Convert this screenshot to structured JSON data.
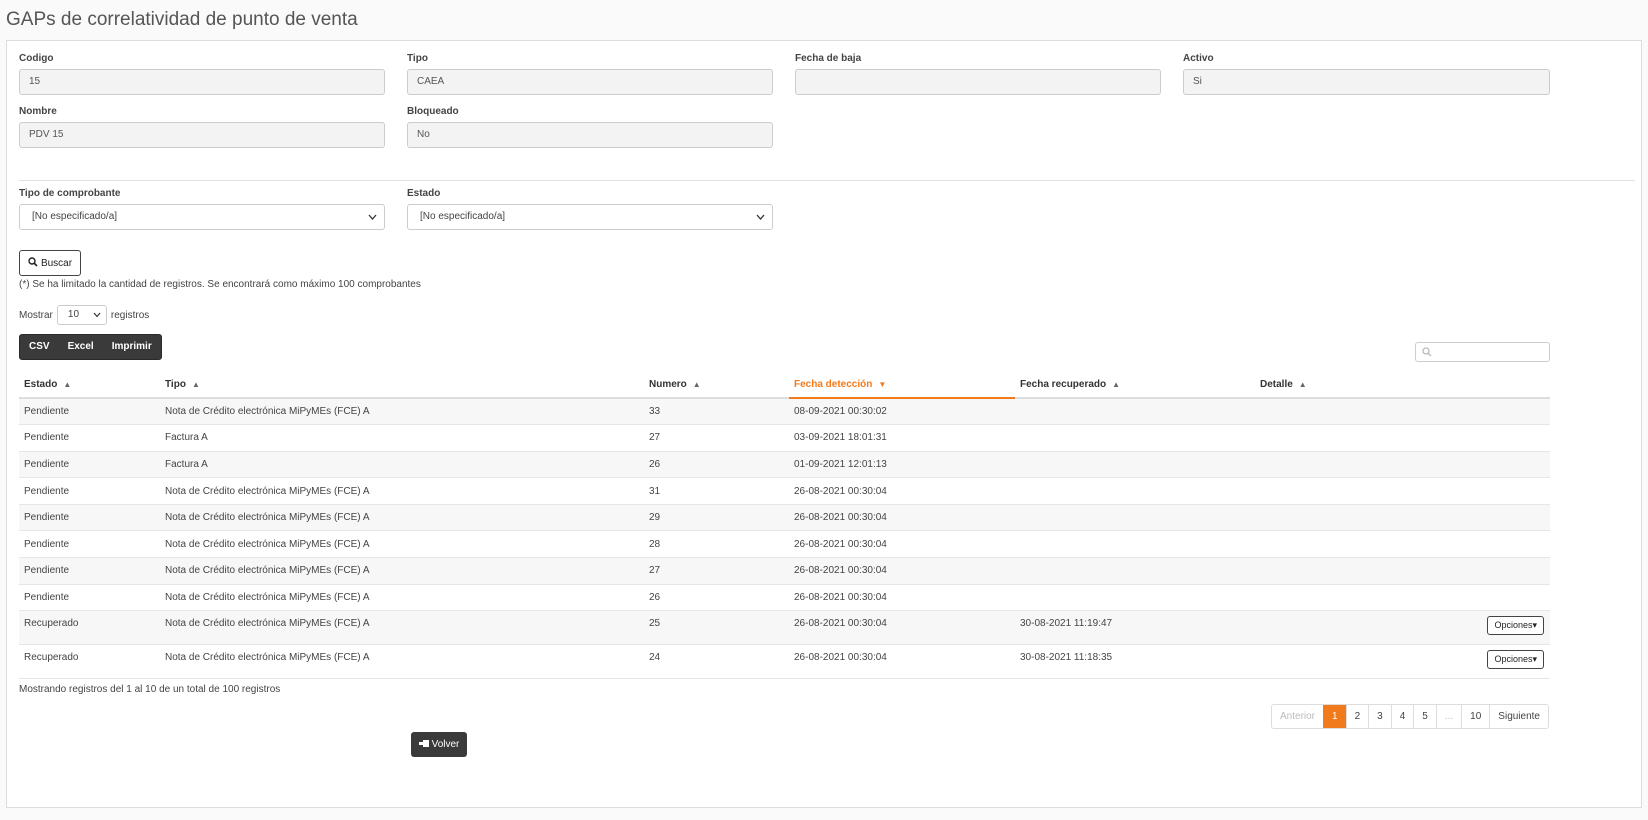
{
  "page_title": "GAPs de correlatividad de punto de venta",
  "fields": {
    "codigo": {
      "label": "Codigo",
      "value": "15"
    },
    "tipo": {
      "label": "Tipo",
      "value": "CAEA"
    },
    "fecha_baja": {
      "label": "Fecha de baja",
      "value": ""
    },
    "activo": {
      "label": "Activo",
      "value": "Si"
    },
    "nombre": {
      "label": "Nombre",
      "value": "PDV 15"
    },
    "bloqueado": {
      "label": "Bloqueado",
      "value": "No"
    }
  },
  "filters": {
    "tipo_comprobante": {
      "label": "Tipo de comprobante",
      "value": "[No especificado/a]"
    },
    "estado": {
      "label": "Estado",
      "value": "[No especificado/a]"
    }
  },
  "buscar_label": "Buscar",
  "limit_note": "(*) Se ha limitado la cantidad de registros. Se encontrará como máximo 100 comprobantes",
  "length": {
    "prefix": "Mostrar",
    "value": "10",
    "suffix": "registros"
  },
  "export_buttons": [
    "CSV",
    "Excel",
    "Imprimir"
  ],
  "table": {
    "columns": [
      "Estado",
      "Tipo",
      "Numero",
      "Fecha detección",
      "Fecha recuperado",
      "Detalle"
    ],
    "sorted_column": "Fecha detección",
    "rows": [
      {
        "estado": "Pendiente",
        "tipo": "Nota de Crédito electrónica MiPyMEs (FCE) A",
        "numero": "33",
        "fecha_det": "08-09-2021 00:30:02",
        "fecha_rec": "",
        "opciones": ""
      },
      {
        "estado": "Pendiente",
        "tipo": "Factura A",
        "numero": "27",
        "fecha_det": "03-09-2021 18:01:31",
        "fecha_rec": "",
        "opciones": ""
      },
      {
        "estado": "Pendiente",
        "tipo": "Factura A",
        "numero": "26",
        "fecha_det": "01-09-2021 12:01:13",
        "fecha_rec": "",
        "opciones": ""
      },
      {
        "estado": "Pendiente",
        "tipo": "Nota de Crédito electrónica MiPyMEs (FCE) A",
        "numero": "31",
        "fecha_det": "26-08-2021 00:30:04",
        "fecha_rec": "",
        "opciones": ""
      },
      {
        "estado": "Pendiente",
        "tipo": "Nota de Crédito electrónica MiPyMEs (FCE) A",
        "numero": "29",
        "fecha_det": "26-08-2021 00:30:04",
        "fecha_rec": "",
        "opciones": ""
      },
      {
        "estado": "Pendiente",
        "tipo": "Nota de Crédito electrónica MiPyMEs (FCE) A",
        "numero": "28",
        "fecha_det": "26-08-2021 00:30:04",
        "fecha_rec": "",
        "opciones": ""
      },
      {
        "estado": "Pendiente",
        "tipo": "Nota de Crédito electrónica MiPyMEs (FCE) A",
        "numero": "27",
        "fecha_det": "26-08-2021 00:30:04",
        "fecha_rec": "",
        "opciones": ""
      },
      {
        "estado": "Pendiente",
        "tipo": "Nota de Crédito electrónica MiPyMEs (FCE) A",
        "numero": "26",
        "fecha_det": "26-08-2021 00:30:04",
        "fecha_rec": "",
        "opciones": ""
      },
      {
        "estado": "Recuperado",
        "tipo": "Nota de Crédito electrónica MiPyMEs (FCE) A",
        "numero": "25",
        "fecha_det": "26-08-2021 00:30:04",
        "fecha_rec": "30-08-2021 11:19:47",
        "opciones": "Opciones"
      },
      {
        "estado": "Recuperado",
        "tipo": "Nota de Crédito electrónica MiPyMEs (FCE) A",
        "numero": "24",
        "fecha_det": "26-08-2021 00:30:04",
        "fecha_rec": "30-08-2021 11:18:35",
        "opciones": "Opciones"
      }
    ]
  },
  "info_text": "Mostrando registros del 1 al 10 de un total de 100 registros",
  "pagination": {
    "prev": "Anterior",
    "pages": [
      "1",
      "2",
      "3",
      "4",
      "5",
      "...",
      "10"
    ],
    "active": "1",
    "next": "Siguiente"
  },
  "volver_label": "Volver",
  "colors": {
    "accent": "#f07a1c",
    "dark_button": "#3a3a3a"
  }
}
